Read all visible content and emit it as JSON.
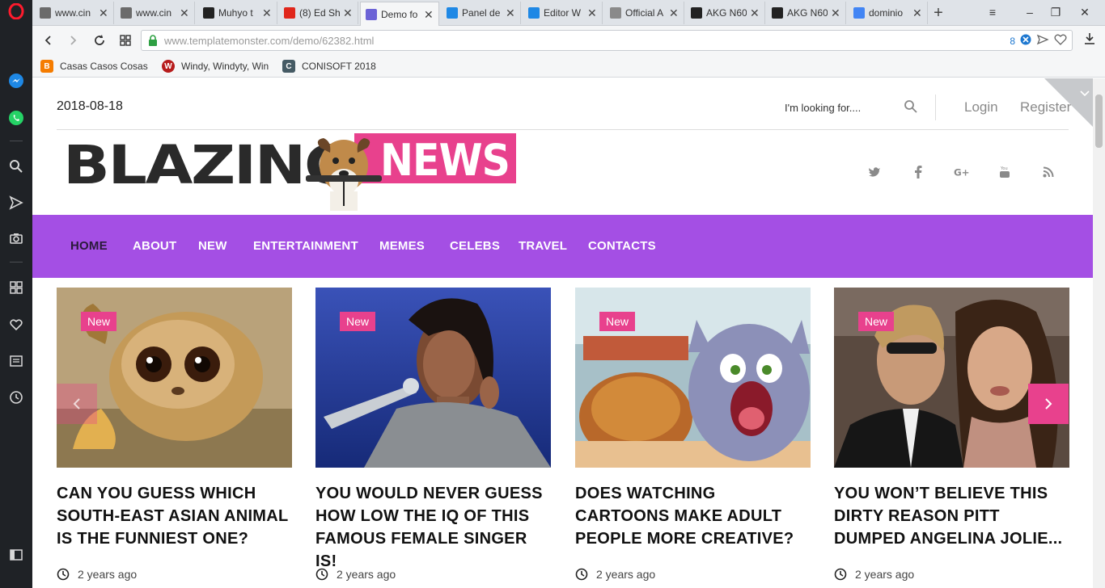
{
  "browser": {
    "tabs": [
      {
        "title": "www.cin",
        "favicon_color": "#6b6b6b",
        "active": false
      },
      {
        "title": "www.cin",
        "favicon_color": "#6b6b6b",
        "active": false
      },
      {
        "title": "Muhyo t",
        "favicon_color": "#222222",
        "active": false
      },
      {
        "title": "(8) Ed Sh",
        "favicon_color": "#e0261b",
        "active": false
      },
      {
        "title": "Demo fo",
        "favicon_color": "#6c63d6",
        "active": true
      },
      {
        "title": "Panel de",
        "favicon_color": "#1e88e5",
        "active": false
      },
      {
        "title": "Editor W",
        "favicon_color": "#1e88e5",
        "active": false
      },
      {
        "title": "Official A",
        "favicon_color": "#8a8a8a",
        "active": false
      },
      {
        "title": "AKG N60",
        "favicon_color": "#222222",
        "active": false
      },
      {
        "title": "AKG N60",
        "favicon_color": "#222222",
        "active": false
      },
      {
        "title": "dominio",
        "favicon_color": "#4285f4",
        "active": false
      }
    ],
    "url_host": "www.templatemonster.com",
    "url_path": "/demo/62382.html",
    "adblock_count": "8",
    "bookmarks": [
      {
        "label": "Casas Casos Cosas y",
        "icon_color": "#f57c00"
      },
      {
        "label": "Windy, Windyty, Win",
        "icon_color": "#b71c1c"
      },
      {
        "label": "CONISOFT 2018",
        "icon_color": "#455a64"
      }
    ]
  },
  "header": {
    "date": "2018-08-18",
    "search_placeholder": "I'm looking for....",
    "login": "Login",
    "register": "Register"
  },
  "logo": {
    "word1": "BLAZING",
    "word2": "NEWS"
  },
  "nav": {
    "items": [
      "HOME",
      "ABOUT",
      "NEW",
      "ENTERTAINMENT",
      "MEMES",
      "CELEBS",
      "TRAVEL",
      "CONTACTS"
    ]
  },
  "cards": [
    {
      "badge": "New",
      "title": "CAN YOU GUESS WHICH SOUTH-EAST ASIAN ANIMAL IS THE FUNNIEST ONE?",
      "meta": "2 years ago"
    },
    {
      "badge": "New",
      "title": "YOU WOULD NEVER GUESS HOW LOW THE IQ OF THIS FAMOUS FEMALE SINGER IS!",
      "meta": "2 years ago"
    },
    {
      "badge": "New",
      "title": "DOES WATCHING CARTOONS MAKE ADULT PEOPLE MORE CREATIVE?",
      "meta": "2 years ago"
    },
    {
      "badge": "New",
      "title": "YOU WON’T BELIEVE THIS DIRTY REASON PITT DUMPED ANGELINA JOLIE...",
      "meta": "2 years ago"
    }
  ],
  "colors": {
    "accent_purple": "#a44fe4",
    "accent_pink": "#e8418d",
    "logo_dark": "#2a2a2a"
  }
}
